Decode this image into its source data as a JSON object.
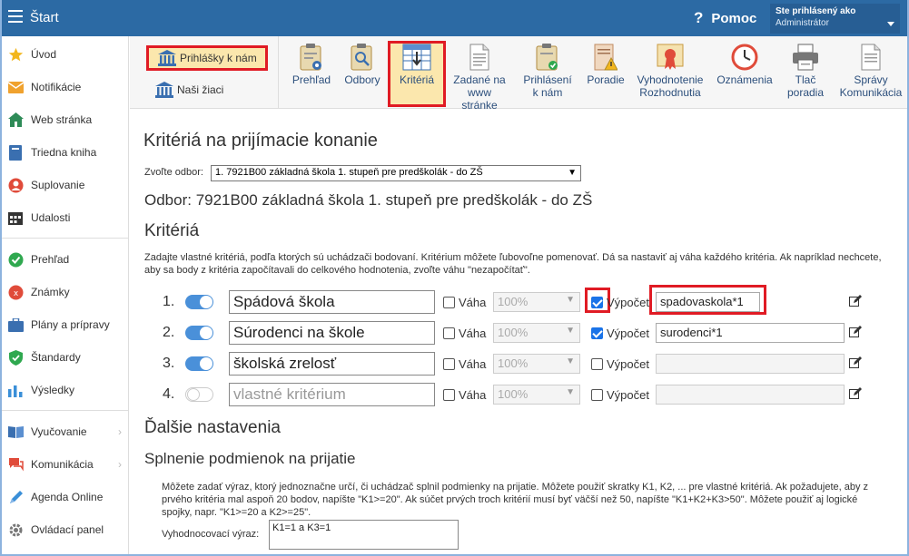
{
  "app": {
    "title": "Štart"
  },
  "header": {
    "help_label": "Pomoc",
    "user_line1": "Ste prihlásený ako",
    "user_line2": "Administrátor"
  },
  "sidebar": {
    "items": [
      {
        "label": "Úvod",
        "icon": "star-icon"
      },
      {
        "label": "Notifikácie",
        "icon": "envelope-icon"
      },
      {
        "label": "Web stránka",
        "icon": "home-icon"
      },
      {
        "label": "Triedna kniha",
        "icon": "book-icon"
      },
      {
        "label": "Suplovanie",
        "icon": "user-icon"
      },
      {
        "label": "Udalosti",
        "icon": "calendar-icon"
      },
      {
        "label": "Prehľad",
        "icon": "check-circle-icon"
      },
      {
        "label": "Známky",
        "icon": "grade-icon"
      },
      {
        "label": "Plány a prípravy",
        "icon": "briefcase-icon"
      },
      {
        "label": "Štandardy",
        "icon": "shield-icon"
      },
      {
        "label": "Výsledky",
        "icon": "bar-chart-icon"
      },
      {
        "label": "Vyučovanie",
        "icon": "book-open-icon"
      },
      {
        "label": "Komunikácia",
        "icon": "chat-icon"
      },
      {
        "label": "Agenda Online",
        "icon": "pen-icon"
      },
      {
        "label": "Ovládací panel",
        "icon": "gear-icon"
      }
    ]
  },
  "toolbar": {
    "prihlasky_label": "Prihlášky k nám",
    "nasi_ziaci_label": "Naši žiaci",
    "tools": [
      {
        "line1": "Prehľad",
        "line2": ""
      },
      {
        "line1": "Odbory",
        "line2": ""
      },
      {
        "line1": "Kritériá",
        "line2": ""
      },
      {
        "line1": "Zadané na",
        "line2": "www stránke"
      },
      {
        "line1": "Prihlásení",
        "line2": "k nám"
      },
      {
        "line1": "Poradie",
        "line2": ""
      },
      {
        "line1": "Vyhodnotenie",
        "line2": "Rozhodnutia"
      },
      {
        "line1": "Oznámenia",
        "line2": ""
      },
      {
        "line1": "Tlač",
        "line2": "poradia"
      },
      {
        "line1": "Správy",
        "line2": "Komunikácia"
      }
    ]
  },
  "main": {
    "title": "Kritériá na prijímacie konanie",
    "odbor_label": "Zvoľte odbor:",
    "odbor_selected": "1. 7921B00 základná škola 1. stupeň pre predškolák - do ZŠ",
    "odbor_heading": "Odbor: 7921B00 základná škola 1. stupeň pre predškolák - do ZŠ",
    "kriteria_heading": "Kritériá",
    "kriteria_desc": "Zadajte vlastné kritériá, podľa ktorých sú uchádzači bodovaní. Kritérium môžete ľubovoľne pomenovať. Dá sa nastaviť aj váha každého kritéria. Ak napríklad nechcete, aby sa body z kritéria započítavali do celkového hodnotenia, zvoľte váhu \"nezapočítať\".",
    "vaha_label": "Váha",
    "vypocet_label": "Výpočet",
    "criteria": [
      {
        "num": "1.",
        "name": "Spádová škola",
        "enabled": true,
        "vaha_checked": false,
        "vaha": "100%",
        "vypocet_checked": true,
        "vypocet": "spadovaskola*1"
      },
      {
        "num": "2.",
        "name": "Súrodenci na škole",
        "enabled": true,
        "vaha_checked": false,
        "vaha": "100%",
        "vypocet_checked": true,
        "vypocet": "surodenci*1"
      },
      {
        "num": "3.",
        "name": "školská zrelosť",
        "enabled": true,
        "vaha_checked": false,
        "vaha": "100%",
        "vypocet_checked": false,
        "vypocet": ""
      },
      {
        "num": "4.",
        "name": "",
        "placeholder": "vlastné kritérium",
        "enabled": false,
        "vaha_checked": false,
        "vaha": "100%",
        "vypocet_checked": false,
        "vypocet": ""
      }
    ],
    "dalsie_heading": "Ďalšie nastavenia",
    "splnenie_heading": "Splnenie podmienok na prijatie",
    "splnenie_desc": "Môžete zadať výraz, ktorý jednoznačne určí, či uchádzač splnil podmienky na prijatie. Môžete použiť skratky K1, K2, ... pre vlastné kritériá. Ak požadujete, aby z prvého kritéria mal aspoň 20 bodov, napíšte \"K1>=20\". Ak súčet prvých troch kritérií musí byť väčší než 50, napíšte \"K1+K2+K3>50\". Môžete použiť aj logické spojky, napr. \"K1>=20 a K2>=25\".",
    "vyhodnocovaci_label": "Vyhodnocovací výraz:",
    "vyhodnocovaci_value": "K1=1 a K3=1"
  },
  "colors": {
    "header": "#2c6aa4",
    "highlight": "#e01b24",
    "accent": "#4a90d9"
  }
}
